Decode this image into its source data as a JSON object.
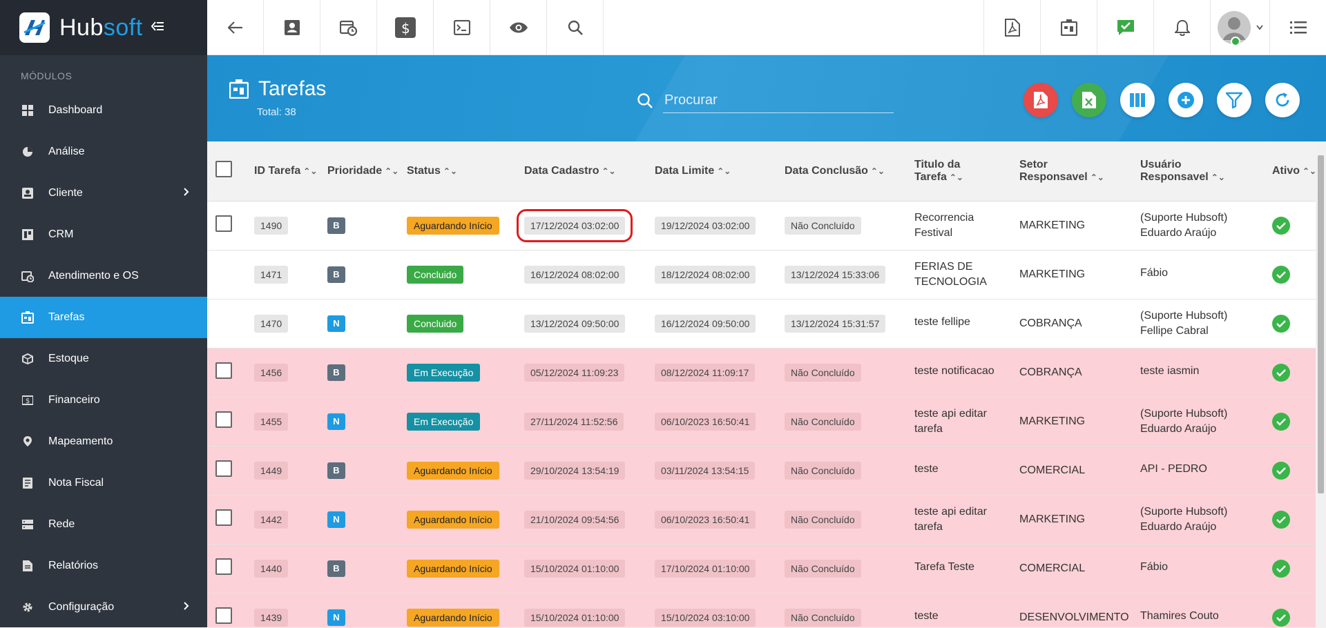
{
  "brand": {
    "name_main": "Hub",
    "name_accent": "soft"
  },
  "sidebar": {
    "section_title": "MÓDULOS",
    "items": [
      {
        "label": "Dashboard"
      },
      {
        "label": "Análise"
      },
      {
        "label": "Cliente"
      },
      {
        "label": "CRM"
      },
      {
        "label": "Atendimento e OS"
      },
      {
        "label": "Tarefas"
      },
      {
        "label": "Estoque"
      },
      {
        "label": "Financeiro"
      },
      {
        "label": "Mapeamento"
      },
      {
        "label": "Nota Fiscal"
      },
      {
        "label": "Rede"
      },
      {
        "label": "Relatórios"
      },
      {
        "label": "Configuração"
      }
    ]
  },
  "header": {
    "title": "Tarefas",
    "total": "Total: 38",
    "search_placeholder": "Procurar"
  },
  "colors": {
    "accent": "#1e9be2",
    "pdf": "#e74040",
    "excel": "#3aaa46",
    "priority_b": "#5d6e7d",
    "priority_n": "#1e9be2",
    "status_waiting": "#f5a623",
    "status_done": "#3aaa46",
    "status_running": "#1591a3"
  },
  "table": {
    "columns": [
      "ID Tarefa",
      "Prioridade",
      "Status",
      "Data Cadastro",
      "Data Limite",
      "Data Conclusão",
      "Titulo da Tarefa",
      "Setor Responsavel",
      "Usuário Responsavel",
      "Ativo"
    ],
    "rows": [
      {
        "id": "1490",
        "prio": "B",
        "status": "Aguardando Início",
        "cadastro": "17/12/2024 03:02:00",
        "limite": "19/12/2024 03:02:00",
        "conclusao": "Não Concluído",
        "titulo1": "Recorrencia",
        "titulo2": "Festival",
        "setor": "MARKETING",
        "usuario1": "(Suporte Hubsoft)",
        "usuario2": "Eduardo Araújo"
      },
      {
        "id": "1471",
        "prio": "B",
        "status": "Concluido",
        "cadastro": "16/12/2024 08:02:00",
        "limite": "18/12/2024 08:02:00",
        "conclusao": "13/12/2024 15:33:06",
        "titulo1": "FERIAS DE",
        "titulo2": "TECNOLOGIA",
        "setor": "MARKETING",
        "usuario1": "Fábio",
        "usuario2": ""
      },
      {
        "id": "1470",
        "prio": "N",
        "status": "Concluido",
        "cadastro": "13/12/2024 09:50:00",
        "limite": "16/12/2024 09:50:00",
        "conclusao": "13/12/2024 15:31:57",
        "titulo1": "teste fellipe",
        "titulo2": "",
        "setor": "COBRANÇA",
        "usuario1": "(Suporte Hubsoft)",
        "usuario2": "Fellipe Cabral"
      },
      {
        "id": "1456",
        "prio": "B",
        "status": "Em Execução",
        "cadastro": "05/12/2024 11:09:23",
        "limite": "08/12/2024 11:09:17",
        "conclusao": "Não Concluído",
        "titulo1": "teste notificacao",
        "titulo2": "",
        "setor": "COBRANÇA",
        "usuario1": "teste iasmin",
        "usuario2": ""
      },
      {
        "id": "1455",
        "prio": "N",
        "status": "Em Execução",
        "cadastro": "27/11/2024 11:52:56",
        "limite": "06/10/2023 16:50:41",
        "conclusao": "Não Concluído",
        "titulo1": "teste api editar",
        "titulo2": "tarefa",
        "setor": "MARKETING",
        "usuario1": "(Suporte Hubsoft)",
        "usuario2": "Eduardo Araújo"
      },
      {
        "id": "1449",
        "prio": "B",
        "status": "Aguardando Início",
        "cadastro": "29/10/2024 13:54:19",
        "limite": "03/11/2024 13:54:15",
        "conclusao": "Não Concluído",
        "titulo1": "teste",
        "titulo2": "",
        "setor": "COMERCIAL",
        "usuario1": "API - PEDRO",
        "usuario2": ""
      },
      {
        "id": "1442",
        "prio": "N",
        "status": "Aguardando Início",
        "cadastro": "21/10/2024 09:54:56",
        "limite": "06/10/2023 16:50:41",
        "conclusao": "Não Concluído",
        "titulo1": "teste api editar",
        "titulo2": "tarefa",
        "setor": "MARKETING",
        "usuario1": "(Suporte Hubsoft)",
        "usuario2": "Eduardo Araújo"
      },
      {
        "id": "1440",
        "prio": "B",
        "status": "Aguardando Início",
        "cadastro": "15/10/2024 01:10:00",
        "limite": "17/10/2024 01:10:00",
        "conclusao": "Não Concluído",
        "titulo1": "Tarefa Teste",
        "titulo2": "",
        "setor": "COMERCIAL",
        "usuario1": "Fábio",
        "usuario2": ""
      },
      {
        "id": "1439",
        "prio": "N",
        "status": "Aguardando Início",
        "cadastro": "15/10/2024 01:10:00",
        "limite": "15/10/2024 03:10:00",
        "conclusao": "Não Concluído",
        "titulo1": "teste",
        "titulo2": "",
        "setor": "DESENVOLVIMENTO",
        "usuario1": "Thamires Couto",
        "usuario2": ""
      }
    ]
  }
}
